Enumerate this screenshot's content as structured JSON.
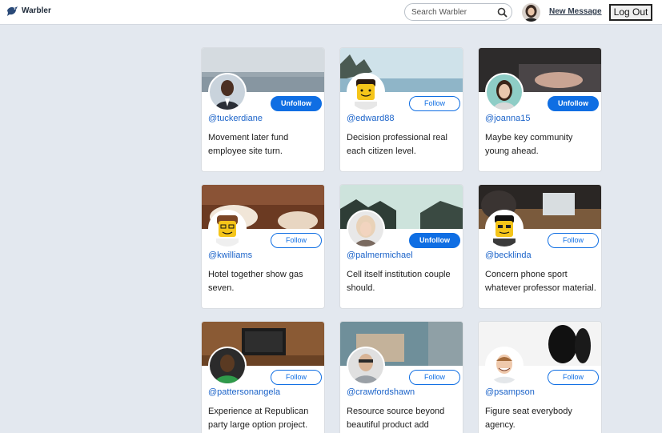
{
  "navbar": {
    "brand": "Warbler",
    "search_placeholder": "Search Warbler",
    "new_message": "New Message",
    "logout": "Log Out"
  },
  "users": [
    {
      "handle": "@tuckerdiane",
      "bio": "Movement later fund employee site turn.",
      "button": "Unfollow"
    },
    {
      "handle": "@edward88",
      "bio": "Decision professional real each citizen level.",
      "button": "Follow"
    },
    {
      "handle": "@joanna15",
      "bio": "Maybe key community young ahead.",
      "button": "Unfollow"
    },
    {
      "handle": "@kwilliams",
      "bio": "Hotel together show gas seven.",
      "button": "Follow"
    },
    {
      "handle": "@palmermichael",
      "bio": "Cell itself institution couple should.",
      "button": "Unfollow"
    },
    {
      "handle": "@becklinda",
      "bio": "Concern phone sport whatever professor material.",
      "button": "Follow"
    },
    {
      "handle": "@pattersonangela",
      "bio": "Experience at Republican party large option project.",
      "button": "Follow"
    },
    {
      "handle": "@crawfordshawn",
      "bio": "Resource source beyond beautiful product add",
      "button": "Follow"
    },
    {
      "handle": "@psampson",
      "bio": "Figure seat everybody agency.",
      "button": "Follow"
    }
  ],
  "colors": {
    "accent": "#0f6ee3",
    "handle": "#1b63c9",
    "page_bg": "#e3e8ef"
  }
}
